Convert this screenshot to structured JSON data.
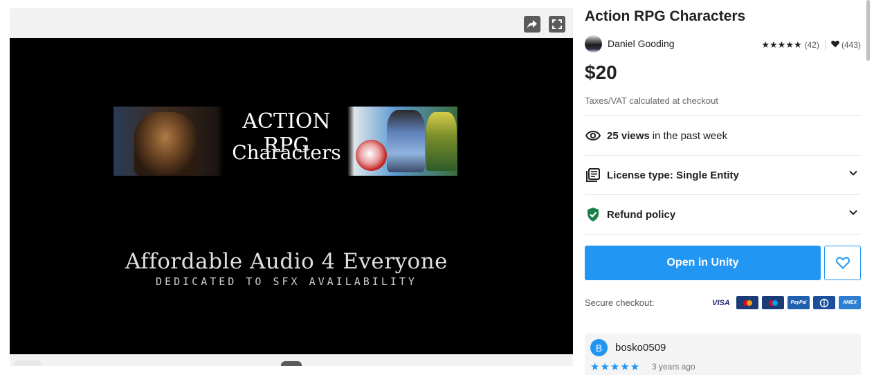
{
  "media": {
    "share_icon": "share-arrow-icon",
    "fullscreen_icon": "fullscreen-icon",
    "banner_title_line1": "ACTION RPG",
    "banner_title_line2": "Characters",
    "tagline": "Affordable Audio 4 Everyone",
    "subtagline": "DEDICATED TO SFX AVAILABILITY"
  },
  "product": {
    "title": "Action RPG Characters",
    "publisher": "Daniel Gooding",
    "rating_stars": "★★★★★",
    "rating_count": "(42)",
    "favorites_count": "(443)",
    "price": "$20",
    "tax_note": "Taxes/VAT calculated at checkout"
  },
  "views": {
    "bold": "25 views",
    "rest": "in the past week"
  },
  "license": {
    "label": "License type: Single Entity"
  },
  "refund": {
    "label": "Refund policy"
  },
  "actions": {
    "open_label": "Open in Unity",
    "secure_label": "Secure checkout:"
  },
  "payments": [
    {
      "name": "visa",
      "label": "VISA"
    },
    {
      "name": "mastercard",
      "label": ""
    },
    {
      "name": "maestro",
      "label": ""
    },
    {
      "name": "paypal",
      "label": "PayPal"
    },
    {
      "name": "diners",
      "label": ""
    },
    {
      "name": "amex",
      "label": "AMEX"
    }
  ],
  "review": {
    "avatar_letter": "B",
    "name": "bosko0509",
    "stars": "★★★★★",
    "date": "3 years ago"
  },
  "colors": {
    "accent": "#2196f3",
    "text": "#212121",
    "muted": "#666666",
    "refund_shield": "#1a7f4b"
  }
}
